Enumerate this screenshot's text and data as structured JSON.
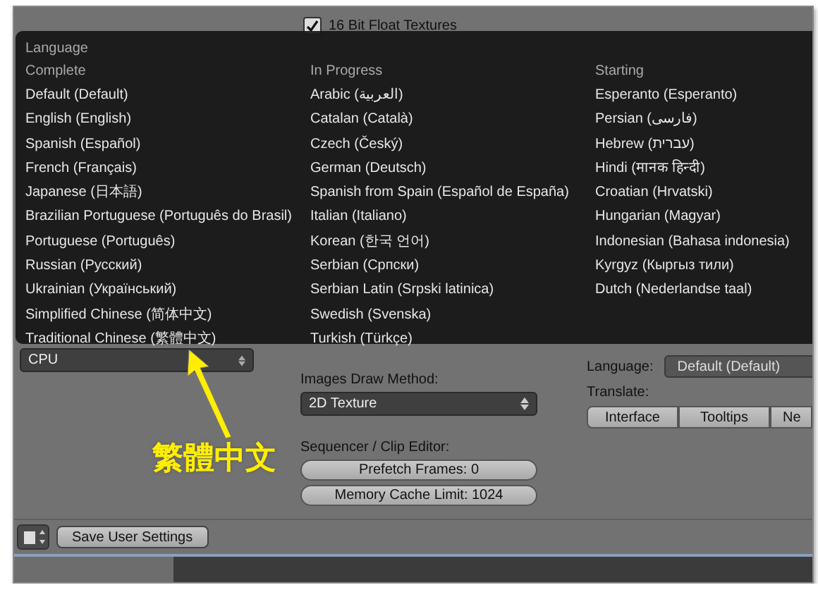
{
  "top_checkbox": {
    "label": "16 Bit Float Textures",
    "checked": true
  },
  "language_menu": {
    "title": "Language",
    "columns": [
      {
        "heading": "Complete",
        "items": [
          "Default (Default)",
          "English (English)",
          "Spanish (Español)",
          "French (Français)",
          "Japanese (日本語)",
          "Brazilian Portuguese (Português do Brasil)",
          "Portuguese (Português)",
          "Russian (Русский)",
          "Ukrainian (Український)",
          "Simplified Chinese (简体中文)",
          "Traditional Chinese (繁體中文)"
        ]
      },
      {
        "heading": "In Progress",
        "items": [
          "Arabic (العربية)",
          "Catalan (Català)",
          "Czech (Český)",
          "German (Deutsch)",
          "Spanish from Spain (Español de España)",
          "Italian (Italiano)",
          "Korean (한국 언어)",
          "Serbian (Српски)",
          "Serbian Latin (Srpski latinica)",
          "Swedish (Svenska)",
          "Turkish (Türkçe)"
        ]
      },
      {
        "heading": "Starting",
        "items": [
          "Esperanto (Esperanto)",
          "Persian (فارسی)",
          "Hebrew (עברית)",
          "Hindi (मानक हिन्दी)",
          "Croatian (Hrvatski)",
          "Hungarian (Magyar)",
          "Indonesian (Bahasa indonesia)",
          "Kyrgyz (Кыргыз тили)",
          "Dutch (Nederlandse taal)"
        ]
      }
    ]
  },
  "compute_device": {
    "value": "CPU"
  },
  "images_draw_method": {
    "label": "Images Draw Method:",
    "value": "2D Texture"
  },
  "sequencer": {
    "label": "Sequencer / Clip Editor:",
    "fields": [
      "Prefetch Frames: 0",
      "Memory Cache Limit: 1024"
    ]
  },
  "language": {
    "label": "Language:",
    "value": "Default (Default)"
  },
  "translate": {
    "label": "Translate:",
    "buttons": [
      "Interface",
      "Tooltips",
      "Ne"
    ]
  },
  "footer": {
    "save_button": "Save User Settings"
  },
  "annotation": {
    "text": "繁體中文"
  }
}
